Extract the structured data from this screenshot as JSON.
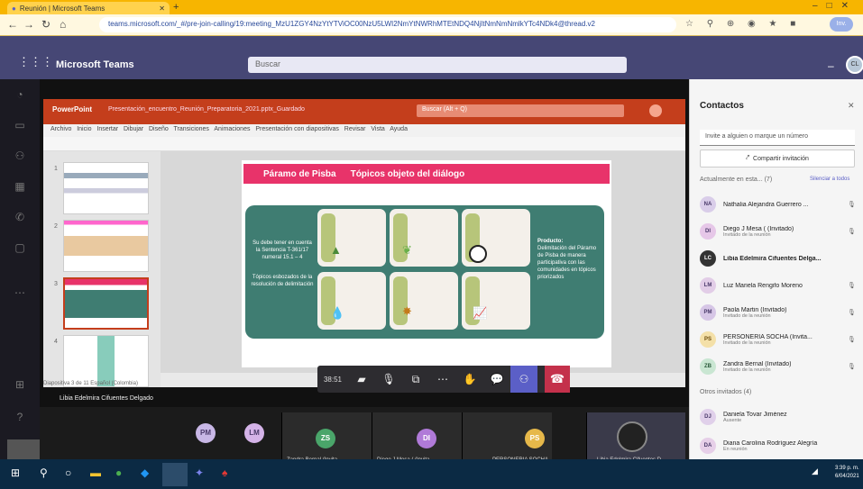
{
  "browser": {
    "tab_title": "Reunión | Microsoft Teams",
    "new_tab": "+",
    "url": "teams.microsoft.com/_#/pre-join-calling/19:meeting_MzU1ZGY4NzYtYTViOC00NzU5LWI2NmYtNWRhMTEtNDQ4NjItNmNmNmlkYTc4NDk4@thread.v2",
    "profile_label": "Inv.",
    "ext_icons": "☆ ⚲ ⊕ ◉ ★ ■"
  },
  "teams": {
    "app_name": "Microsoft Teams",
    "search_placeholder": "Buscar",
    "avatar_initials": "CL"
  },
  "ppt": {
    "brand": "PowerPoint",
    "file_title": "Presentación_encuentro_Reunión_Preparatoria_2021.pptx_Guardado",
    "search_placeholder": "Buscar (Alt + Q)",
    "menu_items": [
      "Archivo",
      "Inicio",
      "Insertar",
      "Dibujar",
      "Diseño",
      "Transiciones",
      "Animaciones",
      "Presentación con diapositivas",
      "Revisar",
      "Vista",
      "Ayuda"
    ],
    "status": "Diapositiva 3 de 11   Español (Colombia)"
  },
  "slide": {
    "title_left": "Páramo de Pisba",
    "title_right": "Tópicos objeto del diálogo",
    "left_text_1": "Su debe tener en cuenta la Sentencia T-361/17 numeral 15.1 – 4",
    "left_text_2": "Tópicos esbozados de la resolución de delimitación",
    "right_heading": "Producto:",
    "right_text": "Delimitación del Páramo de Pisba de manera participativa con las comunidades en tópicos priorizados"
  },
  "controls": {
    "timer": "38:51",
    "icons": [
      "camera-icon",
      "mic-off-icon",
      "share-screen-icon",
      "more-icon",
      "raise-hand-icon",
      "chat-icon",
      "participants-icon"
    ]
  },
  "presenter_label": "Libia Edelmira Cifuentes Delgado",
  "strip": {
    "participants": [
      {
        "initials": "PM",
        "color": "#c8b7e6"
      },
      {
        "initials": "LM",
        "color": "#d4b3e8"
      },
      {
        "initials": "ZS",
        "color": "#4aa56a"
      },
      {
        "initials": "DI",
        "color": "#b07ad8"
      },
      {
        "initials": "PS",
        "color": "#e6b84a"
      }
    ],
    "tile_labels": [
      "Zandra Bernal (Invita...",
      "Diego J Mesa ( (Invita...",
      "PERSONERIA SOCHA...",
      "Libia Edelmira Cifuentes D..."
    ]
  },
  "panel": {
    "title": "Contactos",
    "invite_placeholder": "Invite a alguien o marque un número",
    "share_label": "Compartir invitación",
    "section_current": "Actualmente en esta... (7)",
    "mute_all": "Silenciar a todos",
    "section_others": "Otros invitados (4)",
    "people": [
      {
        "initials": "NA",
        "name": "Nathalia Alejandra Guerrero ...",
        "sub": "",
        "color": "#d9cde9"
      },
      {
        "initials": "DI",
        "name": "Diego J Mesa ( (Invitado)",
        "sub": "Invitado de la reunión",
        "color": "#e6c7e8"
      },
      {
        "initials": "LC",
        "name": "Libia Edelmira Cifuentes Delga...",
        "sub": "",
        "color": "#333333"
      },
      {
        "initials": "LM",
        "name": "Luz Mariela Rengifo Moreno",
        "sub": "",
        "color": "#e2cde7"
      },
      {
        "initials": "PM",
        "name": "Paola Martin (Invitado)",
        "sub": "Invitado de la reunión",
        "color": "#d6c6e6"
      },
      {
        "initials": "PS",
        "name": "PERSONERIA SOCHA (Invita...",
        "sub": "Invitado de la reunión",
        "color": "#f4e0a8"
      },
      {
        "initials": "ZB",
        "name": "Zandra Bernal (Invitado)",
        "sub": "Invitado de la reunión",
        "color": "#c9e6d2"
      }
    ],
    "others": [
      {
        "initials": "DJ",
        "name": "Daniela Tovar Jiménez",
        "sub": "Ausente",
        "color": "#e0d0ea"
      },
      {
        "initials": "DA",
        "name": "Diana Carolina Rodríguez Alegría",
        "sub": "En reunión",
        "color": "#e6cfe8"
      }
    ]
  },
  "taskbar": {
    "time": "3:39 p. m.",
    "date": "6/04/2021"
  }
}
